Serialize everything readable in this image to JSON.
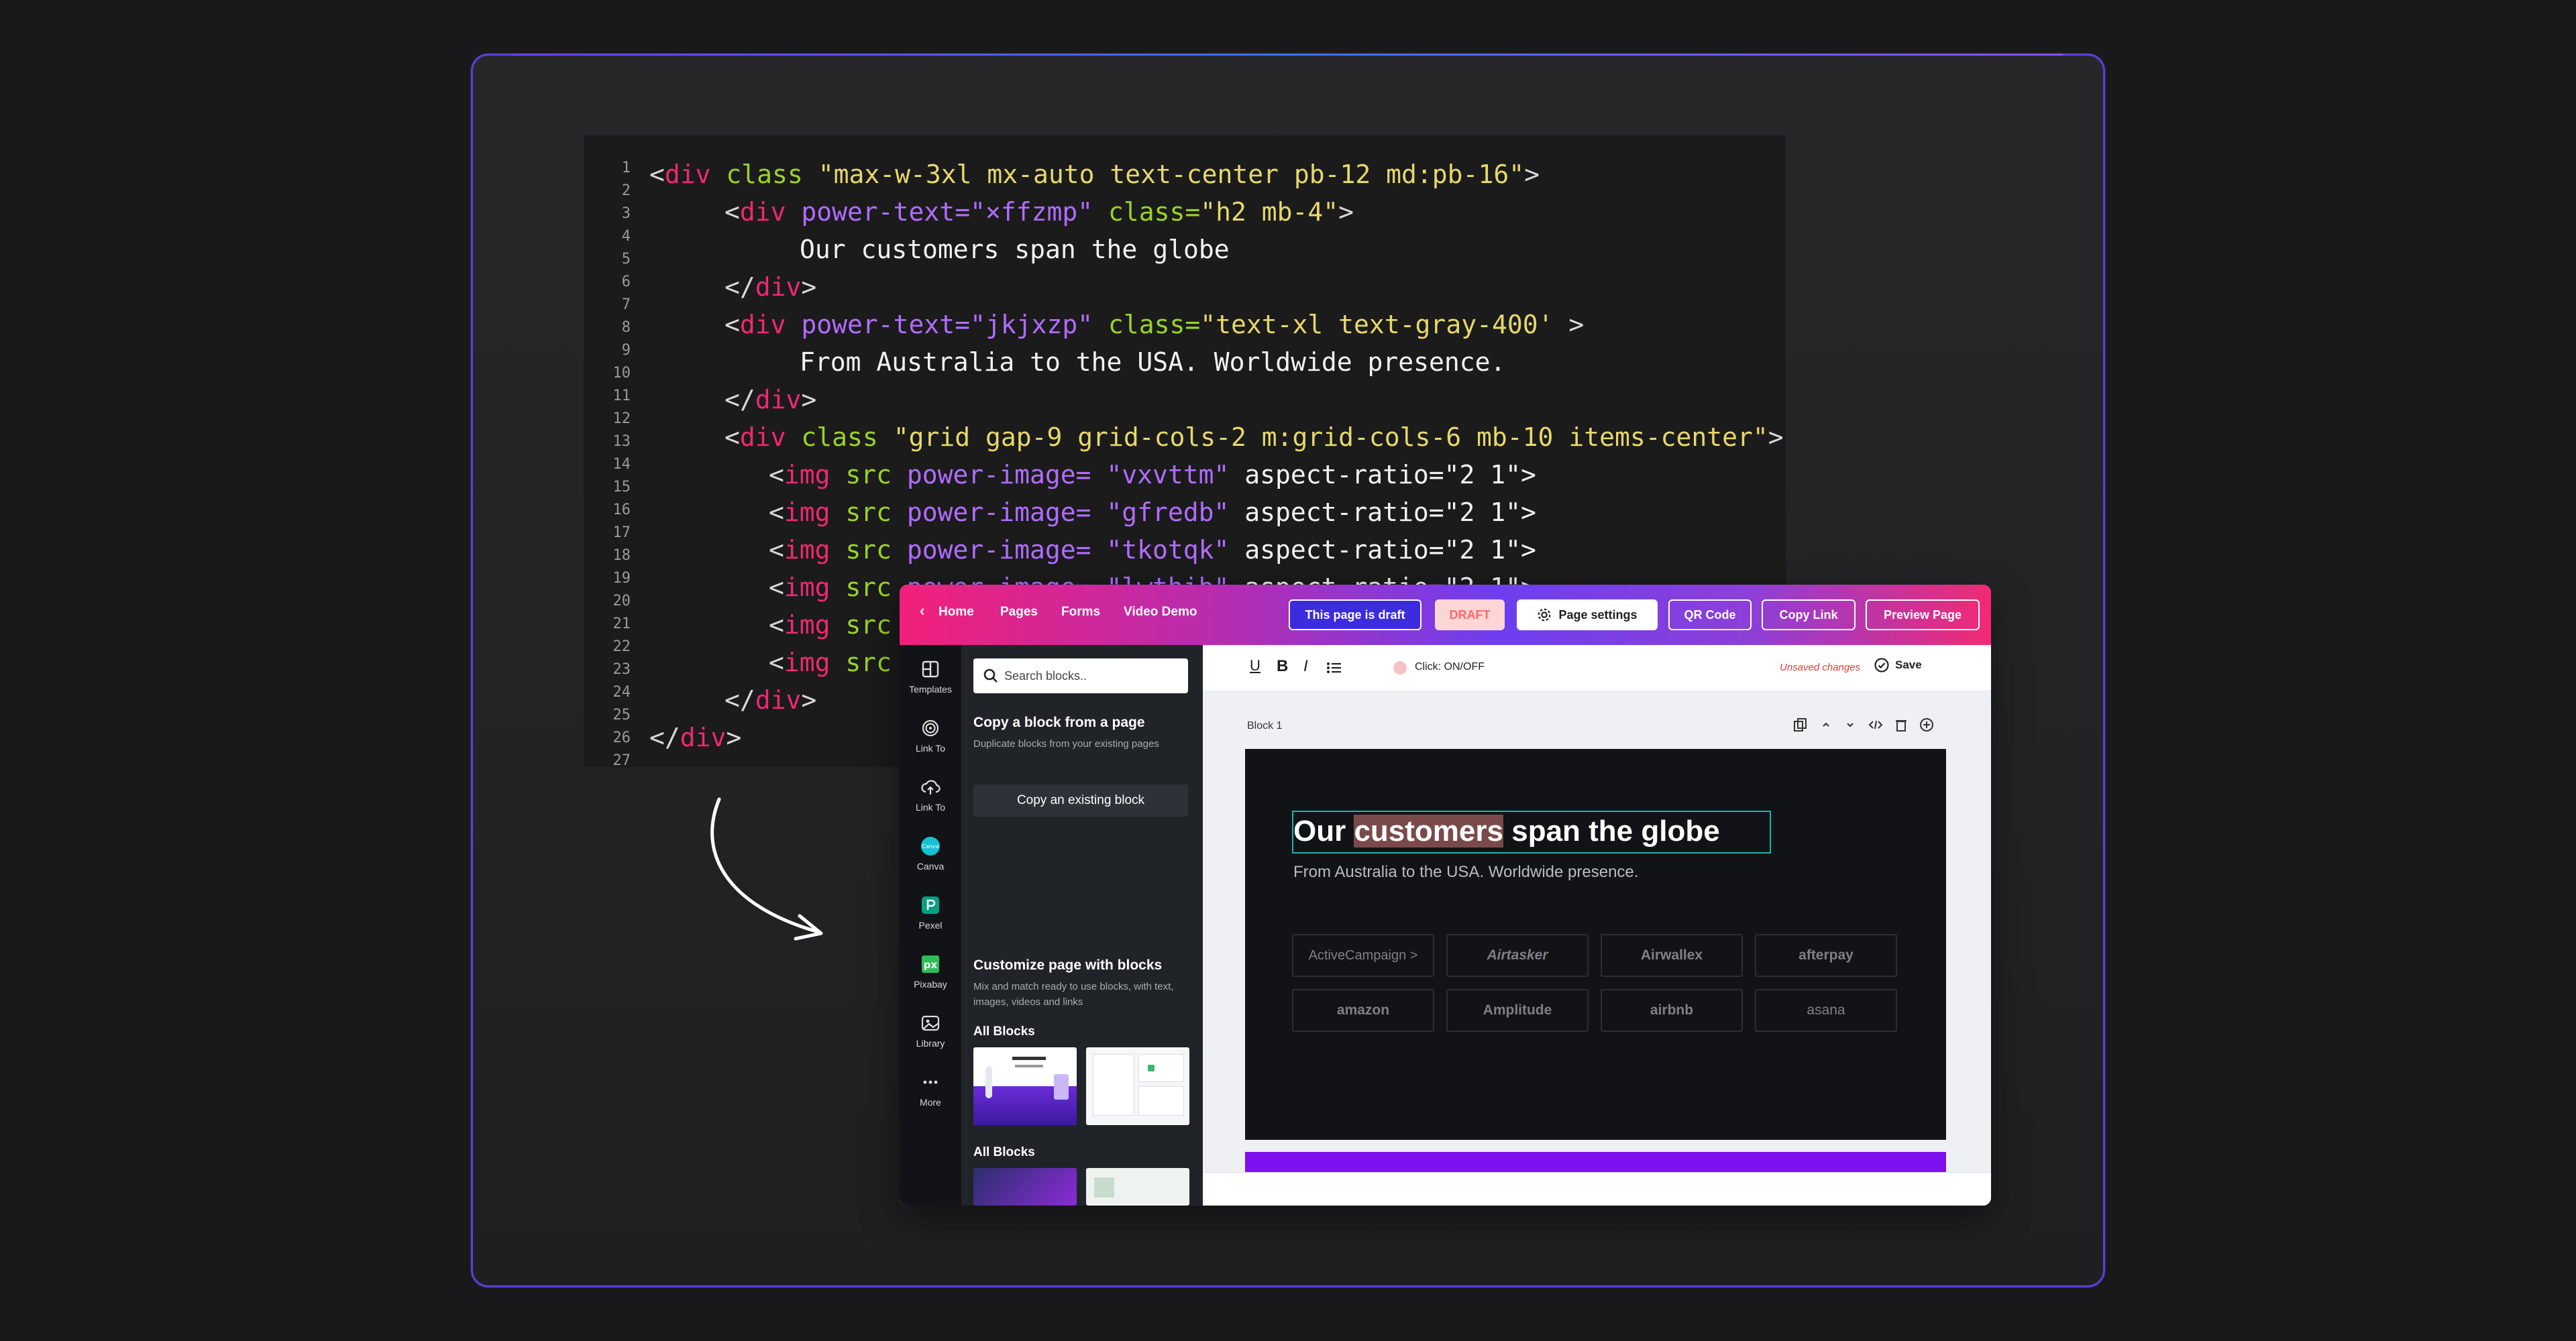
{
  "code": {
    "line_numbers": [
      "1",
      "2",
      "3",
      "4",
      "5",
      "6",
      "7",
      "8",
      "9",
      "10",
      "11",
      "12",
      "13",
      "14",
      "15",
      "16",
      "17",
      "18",
      "19",
      "20",
      "21",
      "22",
      "23",
      "24",
      "25",
      "26",
      "27"
    ],
    "l1": {
      "lt": "<",
      "tag": "div",
      "attr": " class ",
      "val": "\"max-w-3xl mx-auto text-center pb-12 md:pb-16\"",
      "end": ">"
    },
    "l2": {
      "lt": "<",
      "tag": "div",
      "attr": " power-text=",
      "val": "\"×ffzmp\"",
      "attr2": " class=",
      "val2": "\"h2 mb-4\"",
      "end": ">"
    },
    "l3": "Our customers span the globe",
    "l4": {
      "lt": "</",
      "tag": "div",
      "end": ">"
    },
    "l5": {
      "lt": "<",
      "tag": "div",
      "attr": " power-text=",
      "val": "\"jkjxzp\"",
      "attr2": " class=",
      "val2": "\"text-xl text-gray-400'",
      "end": " >"
    },
    "l6": "From Australia to the USA. Worldwide presence.",
    "l7": {
      "lt": "</",
      "tag": "div",
      "end": ">"
    },
    "l8": {
      "lt": "<",
      "tag": "div",
      "attr": " class ",
      "val": "\"grid gap-9 grid-cols-2 m:grid-cols-6 mb-10 items-center\"",
      "end": ">"
    },
    "img_lines": [
      {
        "lt": "<",
        "tag": "img",
        "attr": " src ",
        "attr2": "power-image= ",
        "val": "\"vxvttm\"",
        "tail": " aspect-ratio=\"2 1\">"
      },
      {
        "lt": "<",
        "tag": "img",
        "attr": " src ",
        "attr2": "power-image= ",
        "val": "\"gfredb\"",
        "tail": " aspect-ratio=\"2 1\">"
      },
      {
        "lt": "<",
        "tag": "img",
        "attr": " src ",
        "attr2": "power-image= ",
        "val": "\"tkotqk\"",
        "tail": " aspect-ratio=\"2 1\">"
      },
      {
        "lt": "<",
        "tag": "img",
        "attr": " src ",
        "attr2": "power-image= ",
        "val": "\"lwthib\"",
        "tail": " aspect-ratio=\"2 1\">"
      },
      {
        "lt": "<",
        "tag": "img",
        "attr": " src ",
        "attr2": "",
        "val": "",
        "tail": ""
      },
      {
        "lt": "<",
        "tag": "img",
        "attr": " src ",
        "attr2": "",
        "val": "",
        "tail": ""
      }
    ],
    "l15": {
      "lt": "</",
      "tag": "div",
      "end": ">"
    },
    "l16": {
      "lt": "</",
      "tag": "div",
      "end": ">"
    }
  },
  "app": {
    "nav": {
      "back": "‹",
      "home": "Home",
      "pages": "Pages",
      "forms": "Forms",
      "video": "Video Demo"
    },
    "buttons": {
      "draft": "This page is draft",
      "draft_badge": "DRAFT",
      "settings": "Page settings",
      "qr": "QR Code",
      "copy_link": "Copy Link",
      "preview": "Preview Page"
    },
    "iconbar": {
      "templates": "Templates",
      "link_to_1": "Link To",
      "link_to_2": "Link To",
      "canva": "Canva",
      "pexel": "Pexel",
      "pixabay": "Pixabay",
      "library": "Library",
      "more": "More",
      "canva_glyph": "Canva",
      "pixabay_glyph": "px"
    },
    "panel": {
      "search_placeholder": "Search blocks..",
      "copy_title": "Copy a block from a page",
      "copy_desc": "Duplicate blocks from your existing pages",
      "copy_button": "Copy an existing block",
      "customize_title": "Customize page with blocks",
      "customize_desc": "Mix and match ready to use blocks, with text, images, videos and links",
      "all_blocks_1": "All Blocks",
      "all_blocks_2": "All Blocks",
      "collapse": "‹"
    },
    "toolbar": {
      "underline": "U",
      "bold": "B",
      "italic": "I",
      "click_label": "Click: ON/OFF",
      "unsaved": "Unsaved changes",
      "save": "Save"
    },
    "block": {
      "label": "Block 1",
      "title_part1": "Our ",
      "title_highlight": "customers",
      "title_part2": " span the globe",
      "subtitle": "From Australia to the USA. Worldwide presence.",
      "logos": [
        "ActiveCampaign >",
        "Airtasker",
        "Airwallex",
        "afterpay",
        "amazon",
        "Amplitude",
        "airbnb",
        "asana"
      ]
    },
    "colors": {
      "accent": "#f2207a",
      "purple": "#6d3ff0",
      "selection_outline": "#19b6b0",
      "highlight": "#7a4a4a",
      "bottom_strip": "#7f10f0"
    }
  }
}
